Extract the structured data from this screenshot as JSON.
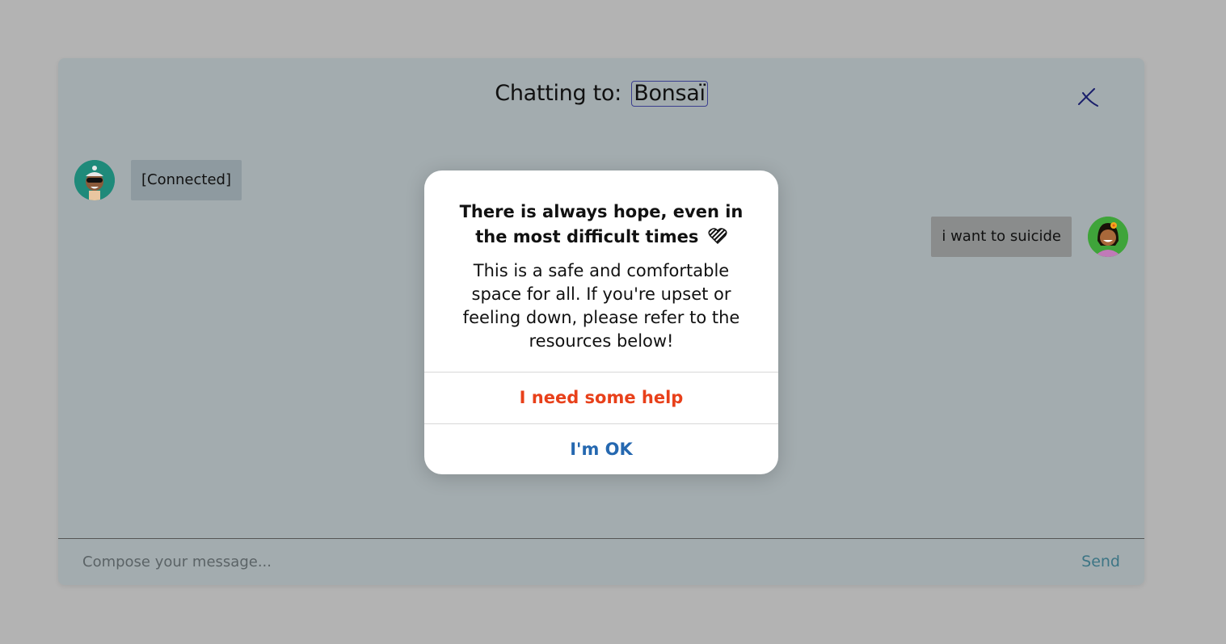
{
  "header": {
    "prefix": "Chatting to:",
    "name": "Bonsaï"
  },
  "messages": [
    {
      "side": "left",
      "text": "[Connected]"
    },
    {
      "side": "right",
      "text": "i want to suicide"
    }
  ],
  "composer": {
    "placeholder": "Compose your message...",
    "value": "",
    "send_label": "Send"
  },
  "modal": {
    "title": "There is always hope, even in the most difficult times",
    "title_emoji": "heart-icon",
    "body": "This is a safe and comfortable space for all. If you're upset or feeling down, please refer to the resources below!",
    "help_label": "I need some help",
    "ok_label": "I'm OK"
  },
  "colors": {
    "help_accent": "#e8401a",
    "ok_accent": "#2568b0",
    "send_accent": "#3d7585"
  }
}
